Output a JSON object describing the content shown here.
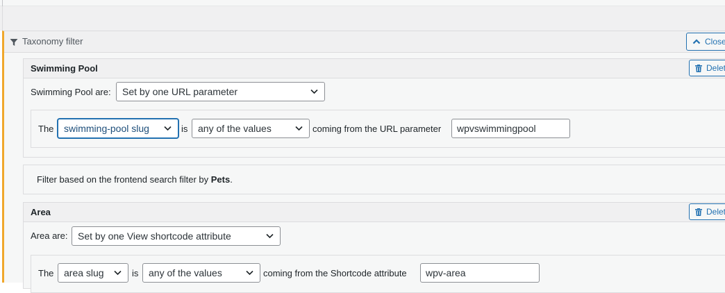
{
  "panel": {
    "title": "Taxonomy filter",
    "close_label": "Close",
    "accent_color": "#f0a72b",
    "link_color": "#2271b1",
    "icons": {
      "filter": "filter-funnel-icon",
      "close": "chevron-up-icon",
      "delete": "trash-icon"
    }
  },
  "swimming_pool": {
    "title": "Swimming Pool",
    "delete_label": "Delete",
    "mode_label": "Swimming Pool are:",
    "mode_value": "Set by one URL parameter",
    "row": {
      "prefix": "The",
      "field_value": "swimming-pool slug",
      "is_label": "is",
      "operator_value": "any of the values",
      "source_label": "coming from the URL parameter",
      "param_value": "wpvswimmingpool"
    }
  },
  "note": {
    "text_before": "Filter based on the frontend search filter by",
    "text_bold": "Pets",
    "text_after": "."
  },
  "area": {
    "title": "Area",
    "delete_label": "Delete",
    "mode_label": "Area are:",
    "mode_value": "Set by one View shortcode attribute",
    "row": {
      "prefix": "The",
      "field_value": "area slug",
      "is_label": "is",
      "operator_value": "any of the values",
      "source_label": "coming from the Shortcode attribute",
      "param_value": "wpv-area"
    }
  }
}
